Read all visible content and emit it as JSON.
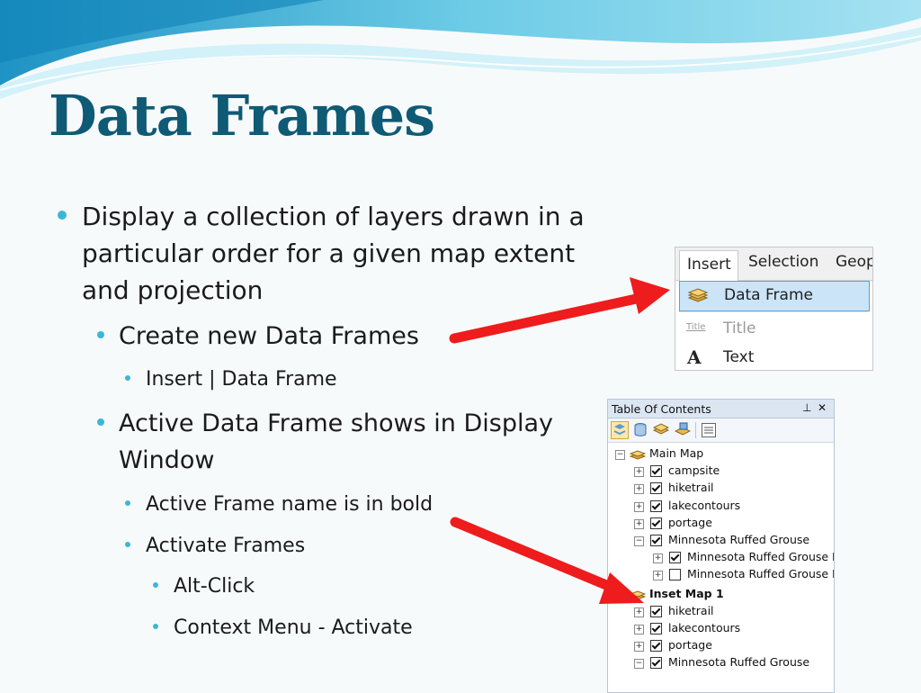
{
  "slide": {
    "title": "Data Frames",
    "bullets": [
      {
        "level": 1,
        "lines": [
          "Display a collection of layers drawn in a",
          "particular order for a given map extent",
          "and projection"
        ]
      },
      {
        "level": 2,
        "lines": [
          "Create new Data Frames"
        ]
      },
      {
        "level": 3,
        "lines": [
          "Insert | Data Frame"
        ]
      },
      {
        "level": 2,
        "lines": [
          "Active Data Frame shows in Display",
          "Window"
        ]
      },
      {
        "level": 3,
        "lines": [
          "Active Frame name is in bold"
        ]
      },
      {
        "level": 3,
        "lines": [
          "Activate Frames"
        ]
      },
      {
        "level": 4,
        "lines": [
          "Alt-Click"
        ]
      },
      {
        "level": 4,
        "lines": [
          "Context Menu - Activate"
        ]
      }
    ]
  },
  "ribbon": {
    "tabs": [
      "Insert",
      "Selection",
      "Geop"
    ],
    "items": [
      {
        "label": "Data Frame",
        "icon": "layers-icon",
        "highlighted": true
      },
      {
        "label": "Title",
        "icon_text": "Title",
        "dim": true
      },
      {
        "label": "Text",
        "icon_text": "A"
      }
    ]
  },
  "toc": {
    "title": "Table Of Contents",
    "pin_glyph": "⊥",
    "close_glyph": "✕",
    "rows": [
      {
        "indent": 0,
        "expander": "−",
        "icon": "layers-icon",
        "label": "Main Map",
        "bold": false
      },
      {
        "indent": 1,
        "expander": "+",
        "checked": true,
        "label": "campsite"
      },
      {
        "indent": 1,
        "expander": "+",
        "checked": true,
        "label": "hiketrail"
      },
      {
        "indent": 1,
        "expander": "+",
        "checked": true,
        "label": "lakecontours"
      },
      {
        "indent": 1,
        "expander": "+",
        "checked": true,
        "label": "portage"
      },
      {
        "indent": 1,
        "expander": "−",
        "checked": true,
        "label": "Minnesota Ruffed Grouse"
      },
      {
        "indent": 2,
        "expander": "+",
        "checked": true,
        "label": "Minnesota Ruffed Grouse Dr"
      },
      {
        "indent": 2,
        "expander": "+",
        "checked": false,
        "label": "Minnesota Ruffed Grouse Dr"
      },
      {
        "indent": 0,
        "expander": "−",
        "icon": "layers-icon",
        "label": "Inset Map 1",
        "bold": true
      },
      {
        "indent": 1,
        "expander": "+",
        "checked": true,
        "label": "hiketrail"
      },
      {
        "indent": 1,
        "expander": "+",
        "checked": true,
        "label": "lakecontours"
      },
      {
        "indent": 1,
        "expander": "+",
        "checked": true,
        "label": "portage"
      },
      {
        "indent": 1,
        "expander": "−",
        "checked": true,
        "label": "Minnesota Ruffed Grouse"
      }
    ]
  },
  "colors": {
    "title": "#0f5a74",
    "bullet": "#3bb7d6",
    "arrow": "#ee1c1c",
    "wave_dark": "#3aa6cf",
    "wave_light": "#bfe6f2"
  }
}
